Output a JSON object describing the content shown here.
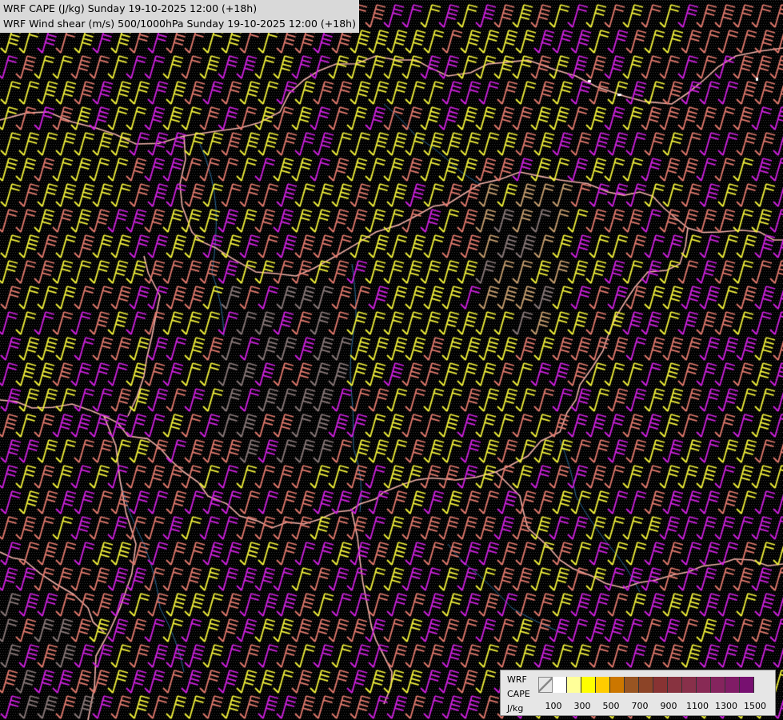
{
  "titles": {
    "line1": "WRF CAPE (J/kg) Sunday 19-10-2025 12:00 (+18h)",
    "line2": "WRF Wind shear (m/s) 500/1000hPa Sunday 19-10-2025 12:00 (+18h)"
  },
  "legend": {
    "label_model": "WRF",
    "label_var": "CAPE",
    "label_unit": "J/kg",
    "colors": [
      "#ffffff",
      "#ffff99",
      "#ffff00",
      "#ffcc00",
      "#cc7700",
      "#995522",
      "#8c4427",
      "#883333",
      "#883340",
      "#88304a",
      "#882a55",
      "#85245e",
      "#801c66",
      "#771070"
    ],
    "ticks": [
      "100",
      "300",
      "500",
      "700",
      "900",
      "1100",
      "1300",
      "1500"
    ]
  },
  "barb_colors": {
    "magenta": "#d020e0",
    "salmon": "#e37a6e",
    "yellow": "#f2f23a",
    "tan": "#c8a070",
    "grey": "#8a7a7a"
  },
  "map_colors": {
    "border": "#f0b0a8",
    "river": "#2a6a9a"
  }
}
